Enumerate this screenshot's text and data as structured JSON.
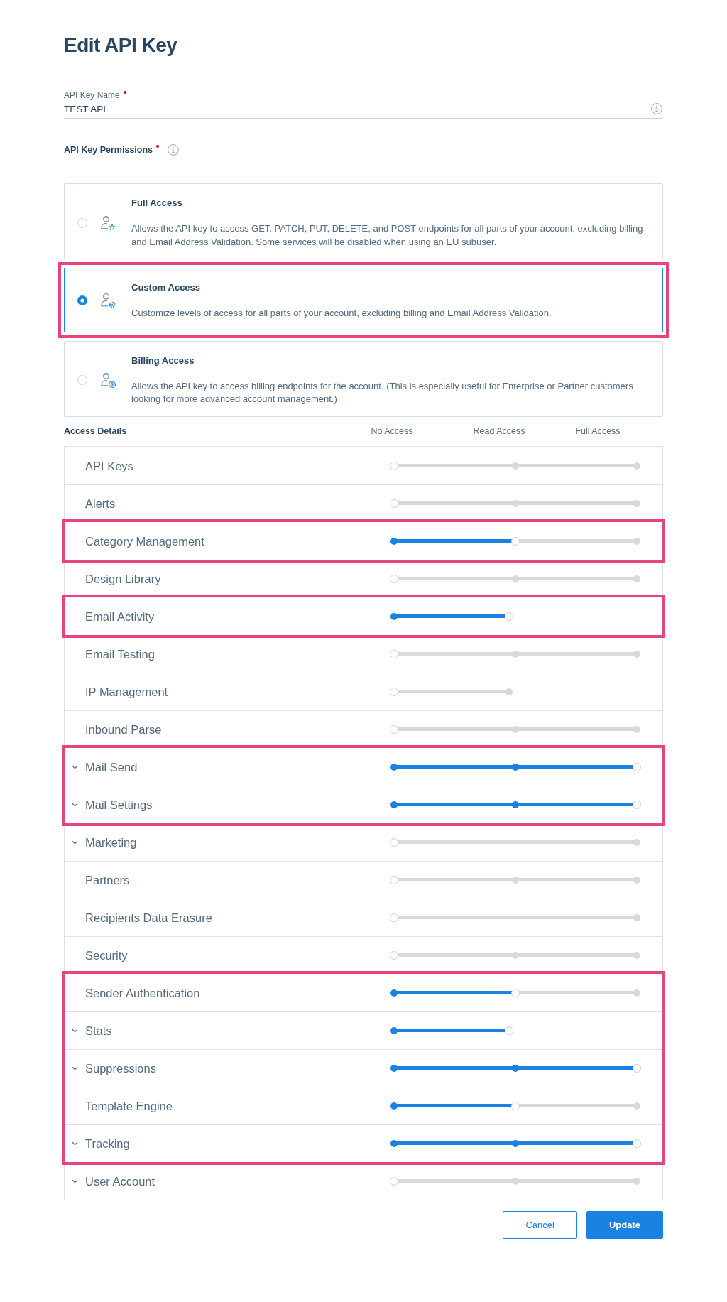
{
  "page": {
    "title": "Edit API Key"
  },
  "name_field": {
    "label": "API Key Name",
    "required": true,
    "value": "TEST API"
  },
  "permissions": {
    "label": "API Key Permissions",
    "required": true,
    "options": [
      {
        "kind": "full",
        "title": "Full Access",
        "description": "Allows the API key to access GET, PATCH, PUT, DELETE, and POST endpoints for all parts of your account, excluding billing and Email Address Validation. Some services will be disabled when using an EU subuser.",
        "selected": false,
        "highlighted": false
      },
      {
        "kind": "custom",
        "title": "Custom Access",
        "description": "Customize levels of access for all parts of your account, excluding billing and Email Address Validation.",
        "selected": true,
        "highlighted": true
      },
      {
        "kind": "billing",
        "title": "Billing Access",
        "description": "Allows the API key to access billing endpoints for the account. (This is especially useful for Enterprise or Partner customers looking for more advanced account management.)",
        "selected": false,
        "highlighted": false
      }
    ]
  },
  "access_details": {
    "title": "Access Details",
    "columns": [
      "No Access",
      "Read Access",
      "Full Access"
    ],
    "rows": [
      {
        "label": "API Keys",
        "kind": "tristate",
        "level": 0,
        "expandable": false,
        "highlighted": false
      },
      {
        "label": "Alerts",
        "kind": "tristate",
        "level": 0,
        "expandable": false,
        "highlighted": false
      },
      {
        "label": "Category Management",
        "kind": "tristate",
        "level": 0.5,
        "expandable": false,
        "highlighted": true
      },
      {
        "label": "Design Library",
        "kind": "tristate",
        "level": 0,
        "expandable": false,
        "highlighted": false
      },
      {
        "label": "Email Activity",
        "kind": "readonly",
        "level": 1,
        "expandable": false,
        "highlighted": true
      },
      {
        "label": "Email Testing",
        "kind": "tristate",
        "level": 0,
        "expandable": false,
        "highlighted": false
      },
      {
        "label": "IP Management",
        "kind": "readonly",
        "level": 0,
        "expandable": false,
        "highlighted": false
      },
      {
        "label": "Inbound Parse",
        "kind": "tristate",
        "level": 0,
        "expandable": false,
        "highlighted": false
      },
      {
        "label": "Mail Send",
        "kind": "tristate",
        "level": 1,
        "expandable": true,
        "highlighted": true
      },
      {
        "label": "Mail Settings",
        "kind": "tristate",
        "level": 1,
        "expandable": true,
        "highlighted": true
      },
      {
        "label": "Marketing",
        "kind": "binary",
        "level": 0,
        "expandable": true,
        "highlighted": false
      },
      {
        "label": "Partners",
        "kind": "tristate",
        "level": 0,
        "expandable": false,
        "highlighted": false
      },
      {
        "label": "Recipients Data Erasure",
        "kind": "binary",
        "level": 0,
        "expandable": false,
        "highlighted": false
      },
      {
        "label": "Security",
        "kind": "tristate",
        "level": 0,
        "expandable": false,
        "highlighted": false
      },
      {
        "label": "Sender Authentication",
        "kind": "tristate",
        "level": 0.5,
        "expandable": false,
        "highlighted": true
      },
      {
        "label": "Stats",
        "kind": "readonly",
        "level": 1,
        "expandable": true,
        "highlighted": true
      },
      {
        "label": "Suppressions",
        "kind": "tristate",
        "level": 1,
        "expandable": true,
        "highlighted": true
      },
      {
        "label": "Template Engine",
        "kind": "tristate",
        "level": 0.5,
        "expandable": false,
        "highlighted": true
      },
      {
        "label": "Tracking",
        "kind": "tristate",
        "level": 1,
        "expandable": true,
        "highlighted": true
      },
      {
        "label": "User Account",
        "kind": "tristate",
        "level": 0,
        "expandable": true,
        "highlighted": false
      }
    ]
  },
  "buttons": [
    {
      "label": "Cancel",
      "kind": "secondary"
    },
    {
      "label": "Update",
      "kind": "primary"
    }
  ]
}
